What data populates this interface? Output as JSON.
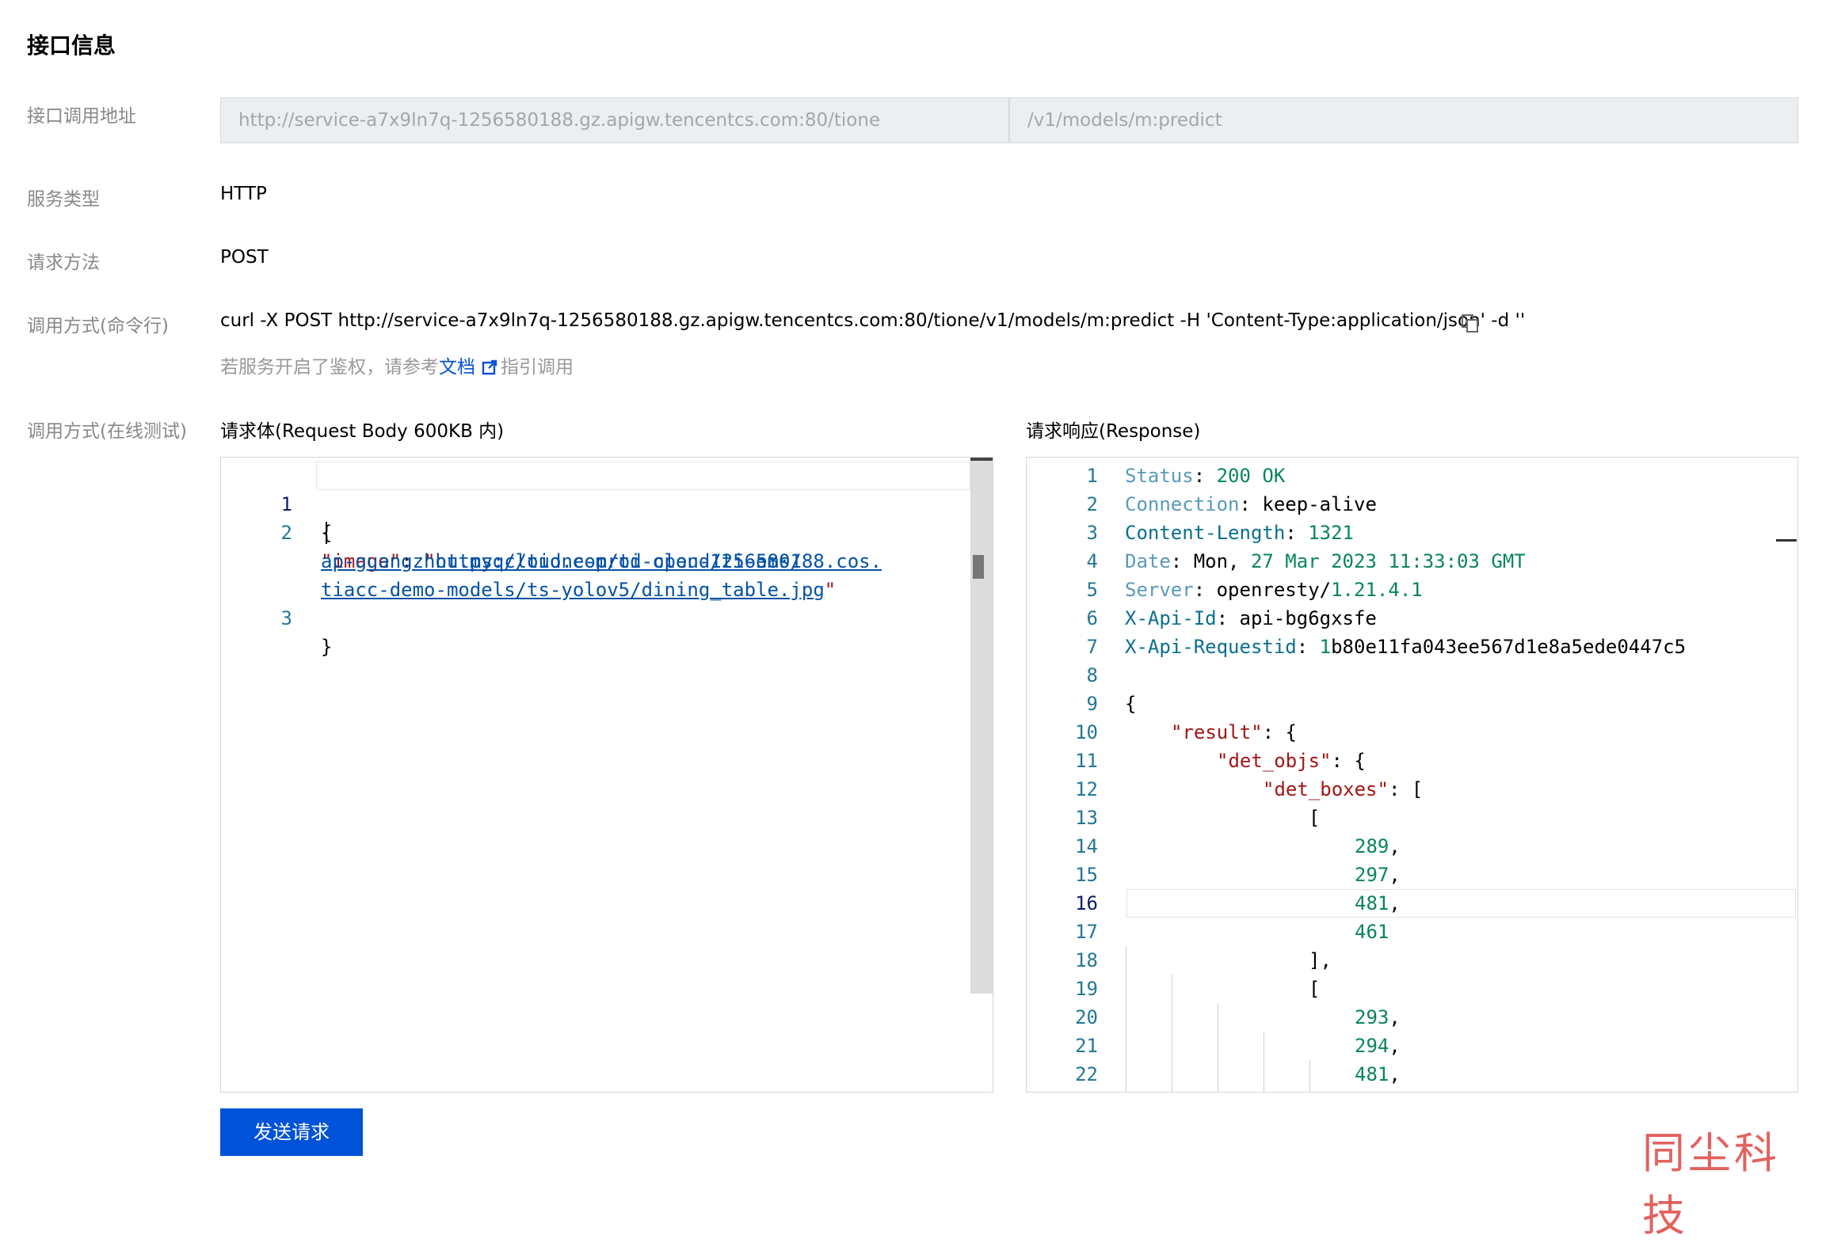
{
  "section": {
    "title": "接口信息"
  },
  "labels": {
    "endpoint": "接口调用地址",
    "service_type": "服务类型",
    "method": "请求方法",
    "cli": "调用方式(命令行)",
    "online": "调用方式(在线测试)"
  },
  "endpoint": {
    "base_url": "http://service-a7x9ln7q-1256580188.gz.apigw.tencentcs.com:80/tione",
    "path": "/v1/models/m:predict"
  },
  "service_type": "HTTP",
  "method": "POST",
  "cli": {
    "command": "curl -X POST http://service-a7x9ln7q-1256580188.gz.apigw.tencentcs.com:80/tione/v1/models/m:predict -H 'Content-Type:application/json' -d ''",
    "hint_prefix": "若服务开启了鉴权，请参考",
    "hint_link": "文档",
    "hint_suffix": "指引调用"
  },
  "request_panel": {
    "title": "请求体(Request Body 600KB 内)",
    "lines": [
      {
        "num": "1",
        "text": "{"
      },
      {
        "num": "2",
        "key": "\"image\"",
        "sep": ": ",
        "quote": "\"",
        "url_1": "https://tione-prod-open-1256580188.cos.",
        "url_2": "ap-guangzhou.myqcloud.com/ti-cloud/ti-ems/",
        "url_3": "tiacc-demo-models/ts-yolov5/dining_table.jpg",
        "end": "\""
      },
      {
        "num": "3",
        "text": "}"
      }
    ]
  },
  "response_panel": {
    "title": "请求响应(Response)",
    "lines": [
      {
        "num": "1",
        "a": "Status",
        "b": ": ",
        "c": "200 OK"
      },
      {
        "num": "2",
        "a": "Connection",
        "b": ": keep-alive"
      },
      {
        "num": "3",
        "a": "Content-Length",
        "b": ": ",
        "c": "1321"
      },
      {
        "num": "4",
        "a": "Date",
        "b": ": Mon, ",
        "c": "27 Mar 2023 11:33:03 GMT"
      },
      {
        "num": "5",
        "a": "Server",
        "b": ": openresty/",
        "c": "1.21.4.1"
      },
      {
        "num": "6",
        "a": "X-Api-Id",
        "b": ": api-bg6gxsfe"
      },
      {
        "num": "7",
        "a": "X-Api-Requestid",
        "b": ": ",
        "c": "1",
        "d": "b80e11fa043ee567d1e8a5ede0447c5"
      },
      {
        "num": "8"
      },
      {
        "num": "9",
        "b": "{"
      },
      {
        "num": "10",
        "k": "\"result\"",
        "b": ": {"
      },
      {
        "num": "11",
        "k": "\"det_objs\"",
        "b": ": {"
      },
      {
        "num": "12",
        "k": "\"det_boxes\"",
        "b": ": ["
      },
      {
        "num": "13",
        "b": "["
      },
      {
        "num": "14",
        "n": "289",
        "b": ","
      },
      {
        "num": "15",
        "n": "297",
        "b": ","
      },
      {
        "num": "16",
        "n": "481",
        "b": ","
      },
      {
        "num": "17",
        "n": "461"
      },
      {
        "num": "18",
        "b": "],"
      },
      {
        "num": "19",
        "b": "["
      },
      {
        "num": "20",
        "n": "293",
        "b": ","
      },
      {
        "num": "21",
        "n": "294",
        "b": ","
      },
      {
        "num": "22",
        "n": "481",
        "b": ","
      }
    ]
  },
  "send_button": "发送请求",
  "watermark": "同尘科技",
  "colors": {
    "primary": "#0052d9",
    "key": "#a31515",
    "number": "#098658",
    "line_number": "#237893"
  }
}
